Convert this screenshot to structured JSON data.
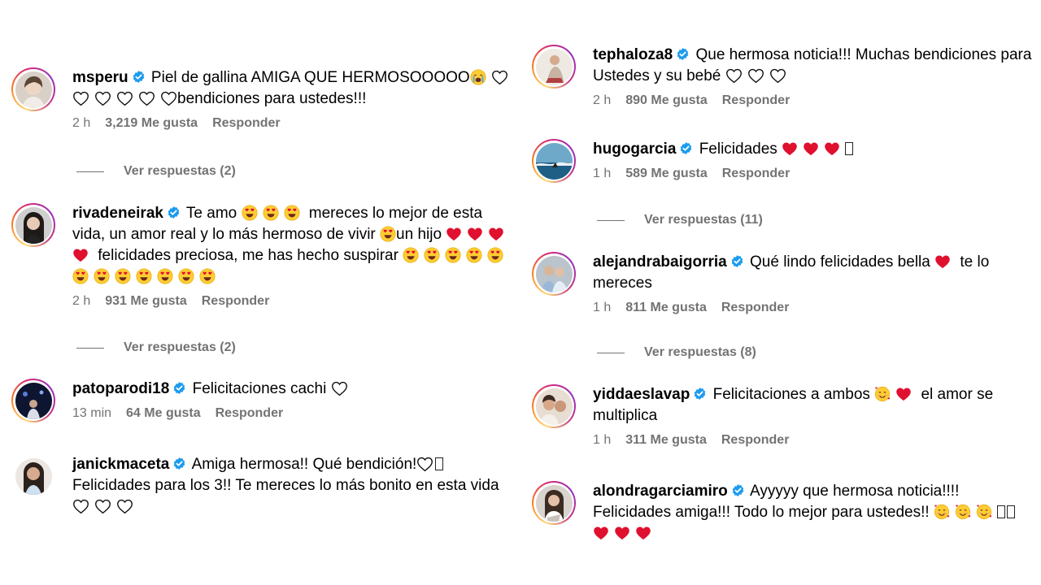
{
  "colors": {
    "verified": "#1d9bf0",
    "meta_text": "#737373",
    "heart_red": "#e0102f",
    "emoji_yellow": "#ffcc33"
  },
  "comments": {
    "mspero": {
      "username": "msperu",
      "text_part1": "Piel de gallina AMIGA QUE HERMOSOOOOO",
      "text_part2": "bendiciones para ustedes!!!",
      "time": "2 h",
      "likes": "3,219 Me gusta",
      "reply": "Responder",
      "replies": "Ver respuestas (2)"
    },
    "rivadeneirak": {
      "username": "rivadeneirak",
      "text_part1": "Te amo",
      "text_part2": "mereces lo mejor de esta vida, un amor real y lo más hermoso de vivir",
      "text_part3": "un hijo",
      "text_part4": "felicidades preciosa, me has hecho suspirar",
      "time": "2 h",
      "likes": "931 Me gusta",
      "reply": "Responder",
      "replies": "Ver respuestas (2)"
    },
    "patoparodi18": {
      "username": "patoparodi18",
      "text_part1": "Felicitaciones cachi",
      "time": "13 min",
      "likes": "64 Me gusta",
      "reply": "Responder"
    },
    "janickmaceta": {
      "username": "janickmaceta",
      "text_part1": "Amiga hermosa!! Qué bendición!",
      "text_part2": "Felicidades para los 3!! Te mereces lo más bonito en esta vida"
    },
    "tephaloza8": {
      "username": "tephaloza8",
      "text_part1": "Que hermosa noticia!!! Muchas bendiciones para Ustedes y su bebé",
      "time": "2 h",
      "likes": "890 Me gusta",
      "reply": "Responder"
    },
    "hugogarcia": {
      "username": "hugogarcia",
      "text_part1": "Felicidades",
      "time": "1 h",
      "likes": "589 Me gusta",
      "reply": "Responder",
      "replies": "Ver respuestas (11)"
    },
    "alejandrabaigorria": {
      "username": "alejandrabaigorria",
      "text_part1": "Qué lindo felicidades bella",
      "text_part2": "te lo mereces",
      "time": "1 h",
      "likes": "811 Me gusta",
      "reply": "Responder",
      "replies": "Ver respuestas (8)"
    },
    "yiddaeslavap": {
      "username": "yiddaeslavap",
      "text_part1": "Felicitaciones a ambos",
      "text_part2": "el amor se multiplica",
      "time": "1 h",
      "likes": "311 Me gusta",
      "reply": "Responder"
    },
    "alondragarciamiro": {
      "username": "alondragarciamiro",
      "text_part1": "Ayyyyy que hermosa noticia!!!! Felicidades amiga!!! Todo lo mejor para ustedes!!"
    }
  },
  "icons": {
    "verified": "verified-badge-icon",
    "heart_outline": "heart-outline-icon",
    "heart_red": "red-heart-icon",
    "heart_eyes": "heart-eyes-emoji-icon",
    "crying": "crying-emoji-icon",
    "smiling_hearts": "smiling-face-with-hearts-icon"
  }
}
